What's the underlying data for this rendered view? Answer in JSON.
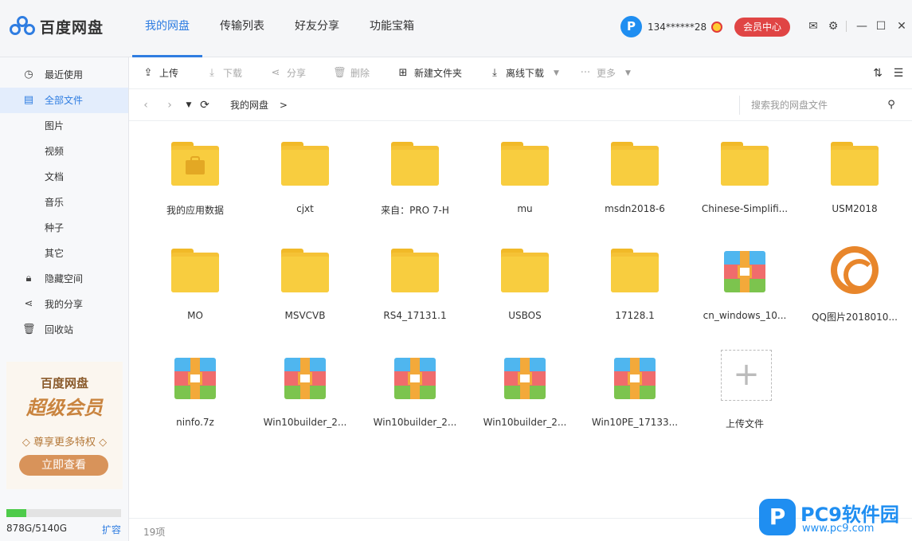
{
  "app": {
    "name": "百度网盘"
  },
  "nav": [
    "我的网盘",
    "传输列表",
    "好友分享",
    "功能宝箱"
  ],
  "user": {
    "avatar_letter": "P",
    "name": "134******28",
    "vip_button": "会员中心"
  },
  "sidebar": {
    "items": [
      {
        "label": "最近使用",
        "icon": "clock-icon"
      },
      {
        "label": "全部文件",
        "icon": "document-icon"
      },
      {
        "label": "图片",
        "icon": ""
      },
      {
        "label": "视频",
        "icon": ""
      },
      {
        "label": "文档",
        "icon": ""
      },
      {
        "label": "音乐",
        "icon": ""
      },
      {
        "label": "种子",
        "icon": ""
      },
      {
        "label": "其它",
        "icon": ""
      },
      {
        "label": "隐藏空间",
        "icon": "lock-icon"
      },
      {
        "label": "我的分享",
        "icon": "share-icon"
      },
      {
        "label": "回收站",
        "icon": "trash-icon"
      }
    ],
    "promo": {
      "title": "百度网盘",
      "big": "超级会员",
      "sub": "◇ 尊享更多特权 ◇",
      "button": "立即查看"
    },
    "quota": {
      "used_fraction": 0.171,
      "text": "878G/5140G",
      "expand": "扩容"
    }
  },
  "toolbar": {
    "upload": "上传",
    "download": "下载",
    "share": "分享",
    "delete": "删除",
    "new_folder": "新建文件夹",
    "offline": "离线下载",
    "more": "更多"
  },
  "address": {
    "crumb": "我的网盘",
    "crumb_sep": ">",
    "search_placeholder": "搜索我的网盘文件"
  },
  "files": [
    {
      "name": "我的应用数据",
      "kind": "folder-lock"
    },
    {
      "name": "cjxt",
      "kind": "folder"
    },
    {
      "name": "来自：PRO 7-H",
      "kind": "folder"
    },
    {
      "name": "mu",
      "kind": "folder"
    },
    {
      "name": "msdn2018-6",
      "kind": "folder"
    },
    {
      "name": "Chinese-Simplifi...",
      "kind": "folder"
    },
    {
      "name": "USM2018",
      "kind": "folder"
    },
    {
      "name": "MO",
      "kind": "folder"
    },
    {
      "name": "MSVCVB",
      "kind": "folder"
    },
    {
      "name": "RS4_17131.1",
      "kind": "folder"
    },
    {
      "name": "USBOS",
      "kind": "folder"
    },
    {
      "name": "17128.1",
      "kind": "folder"
    },
    {
      "name": "cn_windows_10...",
      "kind": "zip"
    },
    {
      "name": "QQ图片2018010...",
      "kind": "image"
    },
    {
      "name": "ninfo.7z",
      "kind": "zip"
    },
    {
      "name": "Win10builder_2...",
      "kind": "zip"
    },
    {
      "name": "Win10builder_2...",
      "kind": "zip"
    },
    {
      "name": "Win10builder_2...",
      "kind": "zip"
    },
    {
      "name": "Win10PE_17133...",
      "kind": "zip"
    },
    {
      "name": "上传文件",
      "kind": "upload"
    }
  ],
  "status": {
    "count": "19项"
  },
  "watermark": {
    "title": "PC9软件园",
    "url": "www.pc9.com",
    "logo": "P"
  }
}
